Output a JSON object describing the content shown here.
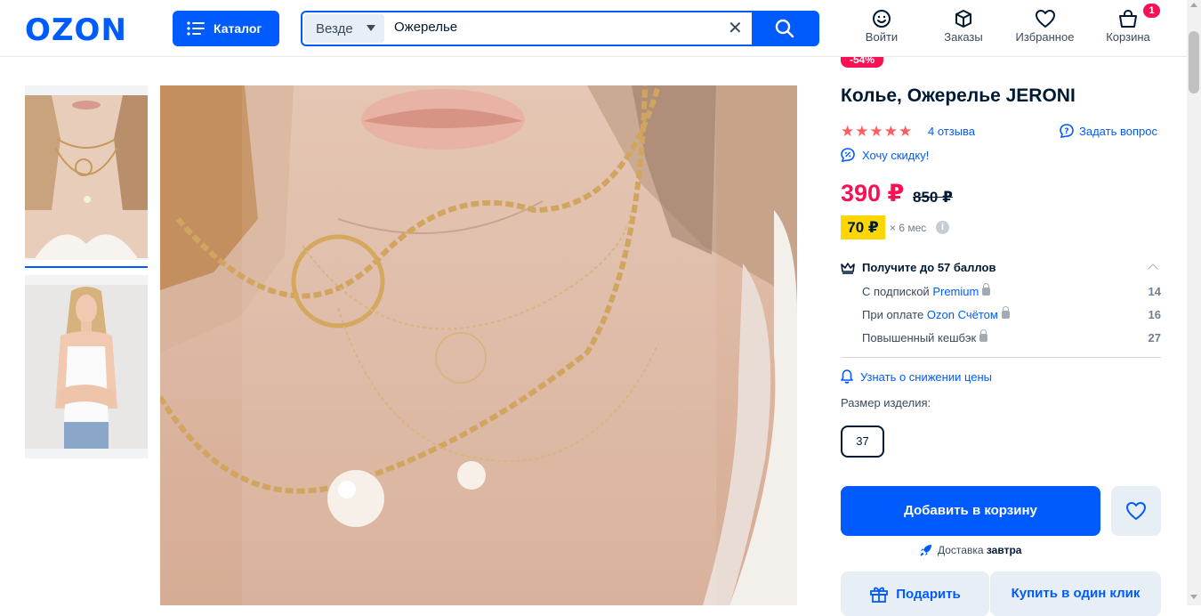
{
  "header": {
    "logo": "OZON",
    "catalog_label": "Каталог",
    "search": {
      "scope": "Везде",
      "value": "Ожерелье",
      "clear_glyph": "✕"
    },
    "nav": [
      {
        "label": "Войти",
        "icon": "smile-icon"
      },
      {
        "label": "Заказы",
        "icon": "box-icon"
      },
      {
        "label": "Избранное",
        "icon": "heart-icon"
      },
      {
        "label": "Корзина",
        "icon": "cart-icon",
        "badge": "1"
      }
    ]
  },
  "product": {
    "discount_badge": "-54%",
    "title": "Колье, Ожерелье JERONI",
    "stars": "★★★★★",
    "reviews": "4 отзыва",
    "ask_question": "Задать вопрос",
    "want_discount": "Хочу скидку!",
    "price": "390 ₽",
    "old_price": "850 ₽",
    "installment": {
      "amount": "70 ₽",
      "term": "× 6 мес",
      "info_glyph": "i"
    },
    "points": {
      "title": "Получите до 57 баллов",
      "rows": [
        {
          "label": "С подпиской ",
          "link": "Premium",
          "value": "14"
        },
        {
          "label": "При оплате ",
          "link": "Ozon Счётом",
          "value": "16"
        },
        {
          "label": "Повышенный кешбэк",
          "link": "",
          "value": "27"
        }
      ]
    },
    "price_alert": "Узнать о снижении цены",
    "size_label": "Размер изделия:",
    "size_value": "37",
    "add_to_cart": "Добавить в корзину",
    "delivery": {
      "prefix": "Доставка ",
      "when": "завтра"
    },
    "gift": "Подарить",
    "one_click": "Купить в один клик"
  },
  "colors": {
    "brand_blue": "#005bff",
    "price_pink": "#f91155",
    "star_color": "#ff5c5c",
    "installment_yellow": "#ffd600"
  }
}
